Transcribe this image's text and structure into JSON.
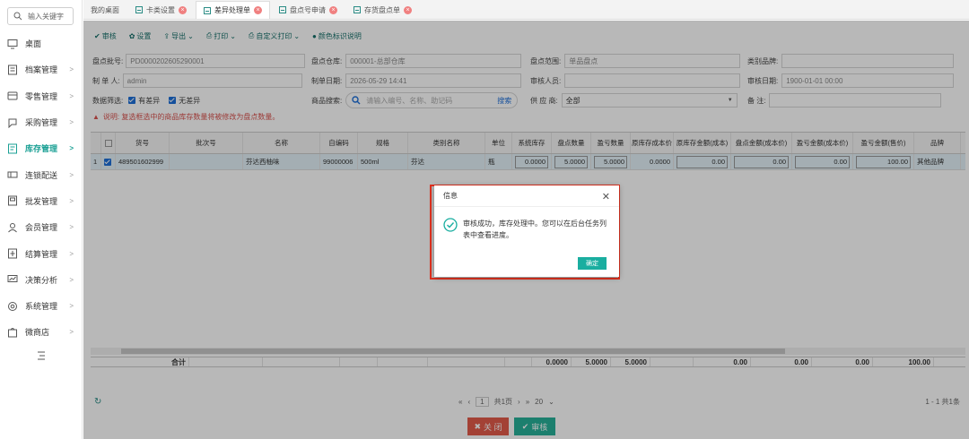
{
  "sidebar": {
    "search_placeholder": "输入关键字",
    "items": [
      {
        "label": "桌面",
        "icon": "monitor-icon",
        "arrow": ""
      },
      {
        "label": "档案管理",
        "icon": "archive-icon",
        "arrow": ">"
      },
      {
        "label": "零售管理",
        "icon": "retail-icon",
        "arrow": ">"
      },
      {
        "label": "采购管理",
        "icon": "purchase-icon",
        "arrow": ">"
      },
      {
        "label": "库存管理",
        "icon": "inventory-icon",
        "arrow": ">"
      },
      {
        "label": "连锁配送",
        "icon": "delivery-icon",
        "arrow": ">"
      },
      {
        "label": "批发管理",
        "icon": "wholesale-icon",
        "arrow": ">"
      },
      {
        "label": "会员管理",
        "icon": "member-icon",
        "arrow": ">"
      },
      {
        "label": "结算管理",
        "icon": "settlement-icon",
        "arrow": ">"
      },
      {
        "label": "决策分析",
        "icon": "analysis-icon",
        "arrow": ">"
      },
      {
        "label": "系统管理",
        "icon": "settings-icon",
        "arrow": ">"
      },
      {
        "label": "微商店",
        "icon": "shop-icon",
        "arrow": ">"
      }
    ]
  },
  "tabs": [
    "我的桌面",
    "卡类设置",
    "差异处理单",
    "盘点号申请",
    "存货盘点单"
  ],
  "toolbar": {
    "audit": "审核",
    "settings": "设置",
    "export": "导出",
    "print": "打印",
    "custom_print": "自定义打印",
    "color_legend": "颜色标识说明"
  },
  "form": {
    "batch_no_label": "盘点批号:",
    "batch_no": "PD0000202605290001",
    "warehouse_label": "盘点仓库:",
    "warehouse": "000001-总部仓库",
    "scope_label": "盘点范围:",
    "scope": "单品盘点",
    "category_label": "类别品牌:",
    "category": "",
    "maker_label": "制 单 人:",
    "maker": "admin",
    "make_date_label": "制单日期:",
    "make_date": "2026-05-29 14:41",
    "auditor_label": "审核人员:",
    "auditor": "",
    "audit_date_label": "审核日期:",
    "audit_date": "1900-01-01 00:00",
    "filter_label": "数据筛选:",
    "filter_diff": "有差异",
    "filter_nodiff": "无差异",
    "product_search_label": "商品搜索:",
    "product_search_placeholder": "请输入编号、名称、助记码",
    "search_button": "搜索",
    "supplier_label": "供 应 商:",
    "supplier": "全部",
    "remark_label": "备   注:",
    "remark": "",
    "hint": "说明: 复选框选中的商品库存数量将被修改为盘点数量。"
  },
  "table": {
    "headers": [
      "",
      "货号",
      "批次号",
      "名称",
      "自编码",
      "规格",
      "类别名称",
      "单位",
      "系统库存",
      "盘点数量",
      "盈亏数量",
      "原库存成本价",
      "原库存金额(成本)",
      "盘点金额(成本价)",
      "盈亏金额(成本价)",
      "盈亏金额(售价)",
      "品牌"
    ],
    "row": {
      "index": "1",
      "code": "489501602999",
      "batch": "",
      "name": "芬达西柚味",
      "self_code": "99000006",
      "spec": "500ml",
      "category": "芬达",
      "unit": "瓶",
      "sys_stock": "0.0000",
      "count_qty": "5.0000",
      "diff_qty": "5.0000",
      "cost_price": "0.0000",
      "orig_amount": "0.00",
      "count_amount": "0.00",
      "diff_amount_cost": "0.00",
      "diff_amount_sale": "100.00",
      "brand": "其他品牌"
    },
    "footer": {
      "label": "合计",
      "sys_stock": "0.0000",
      "count_qty": "5.0000",
      "diff_qty": "5.0000",
      "orig_amount": "0.00",
      "count_amount": "0.00",
      "diff_amount_cost": "0.00",
      "diff_amount_sale": "100.00"
    }
  },
  "pager": {
    "page": "1",
    "total_pages": "共1页",
    "page_size": "20",
    "range": "1 - 1  共1条"
  },
  "bottom": {
    "close": "关 闭",
    "audit": "审核"
  },
  "dialog": {
    "title": "信息",
    "message": "审核成功，库存处理中。您可以在后台任务列表中查看进度。",
    "ok": "确定"
  }
}
